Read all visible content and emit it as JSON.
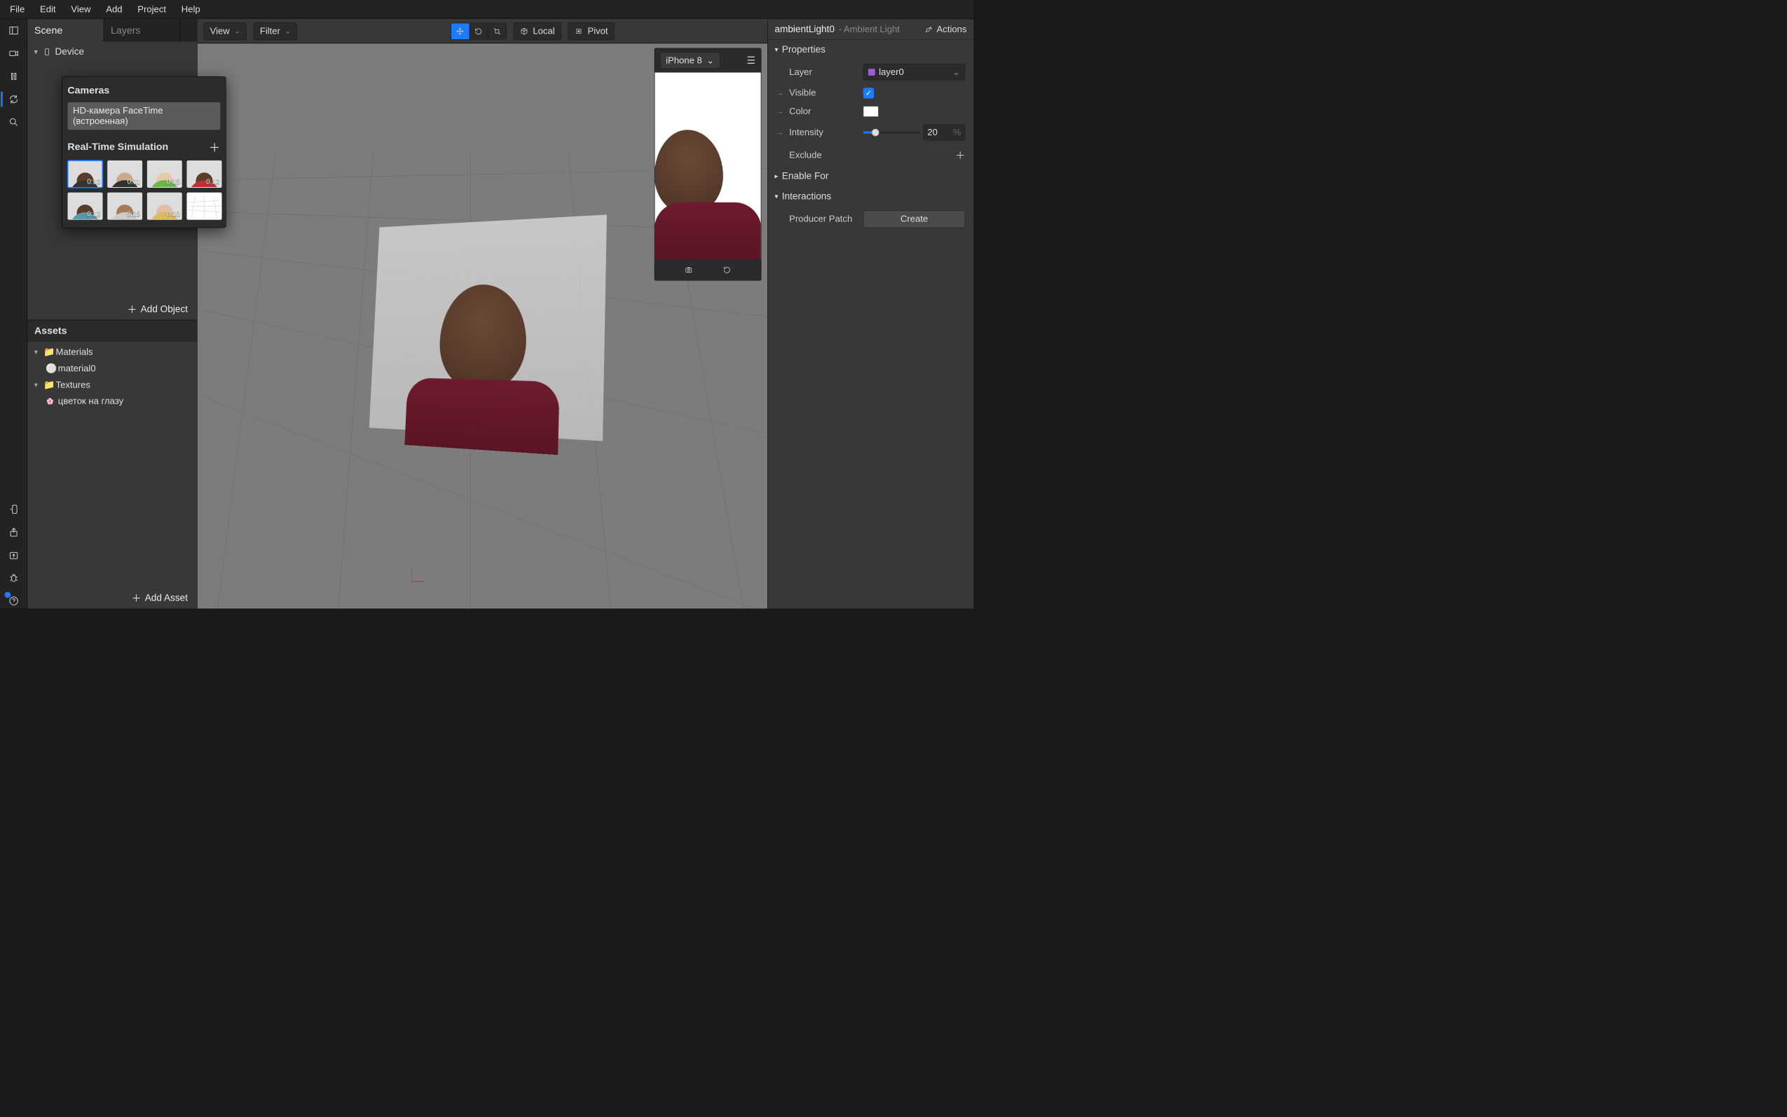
{
  "menu": [
    "File",
    "Edit",
    "View",
    "Add",
    "Project",
    "Help"
  ],
  "leftpanel": {
    "tabs": {
      "scene": "Scene",
      "layers": "Layers"
    },
    "root": "Device",
    "add_object": "Add Object",
    "add_asset": "Add Asset"
  },
  "popover": {
    "cameras_title": "Cameras",
    "camera_name": "HD-камера FaceTime (встроенная)",
    "rts_title": "Real-Time Simulation",
    "thumbs": [
      {
        "t": "0:13",
        "sel": true,
        "skin": "#5a3c28",
        "shirt": "#333"
      },
      {
        "t": "0:11",
        "sel": false,
        "skin": "#caa98b",
        "shirt": "#333"
      },
      {
        "t": "0:15",
        "sel": false,
        "skin": "#e6c9a8",
        "shirt": "#6b4"
      },
      {
        "t": "0:12",
        "sel": false,
        "skin": "#5a3c28",
        "shirt": "#b33"
      },
      {
        "t": "0:12",
        "sel": false,
        "skin": "#5a3c28",
        "shirt": "#59a"
      },
      {
        "t": "0:15",
        "sel": false,
        "skin": "#a87a56",
        "shirt": "#ccc"
      },
      {
        "t": "0:10",
        "sel": false,
        "skin": "#e0c0a0",
        "shirt": "#db5"
      },
      {
        "t": "",
        "sel": false,
        "empty": true
      }
    ]
  },
  "assets": {
    "title": "Assets",
    "folders": {
      "materials": "Materials",
      "material0": "material0",
      "textures": "Textures",
      "texture0": "цветок на глазу"
    }
  },
  "viewport": {
    "view": "View",
    "filter": "Filter",
    "local": "Local",
    "pivot": "Pivot"
  },
  "preview": {
    "device": "iPhone 8"
  },
  "inspector": {
    "name": "ambientLight0",
    "type": "- Ambient Light",
    "actions": "Actions",
    "sections": {
      "properties": "Properties",
      "enable_for": "Enable For",
      "interactions": "Interactions"
    },
    "layer_label": "Layer",
    "layer_value": "layer0",
    "visible_label": "Visible",
    "color_label": "Color",
    "intensity_label": "Intensity",
    "intensity_value": "20",
    "exclude_label": "Exclude",
    "producer_label": "Producer Patch",
    "create_btn": "Create"
  }
}
